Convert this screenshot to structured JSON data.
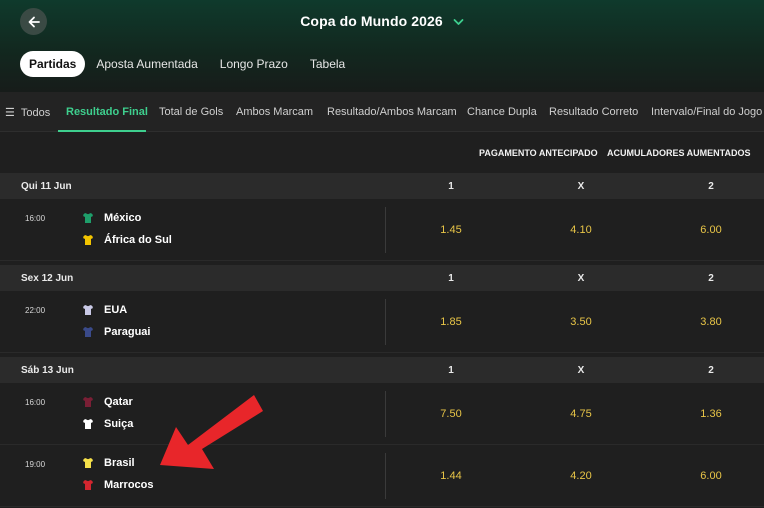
{
  "header": {
    "title": "Copa do Mundo 2026"
  },
  "top_tabs": [
    "Partidas",
    "Aposta Aumentada",
    "Longo Prazo",
    "Tabela"
  ],
  "markets": {
    "all_label": "Todos",
    "items": [
      "Resultado Final",
      "Total de Gols",
      "Ambos Marcam",
      "Resultado/Ambos Marcam",
      "Chance Dupla",
      "Resultado Correto",
      "Intervalo/Final do Jogo"
    ]
  },
  "columns": {
    "early_payout": "PAGAMENTO ANTECIPADO",
    "boosted_acca": "ACUMULADORES AUMENTADOS",
    "home": "1",
    "draw": "X",
    "away": "2"
  },
  "days": [
    {
      "date": "Qui 11 Jun",
      "matches": [
        {
          "time": "16:00",
          "home": "México",
          "away": "África do Sul",
          "odd_1": "1.45",
          "odd_x": "4.10",
          "odd_2": "6.00",
          "home_color": "#1e9e6a",
          "away_color": "#f2c400"
        }
      ]
    },
    {
      "date": "Sex 12 Jun",
      "matches": [
        {
          "time": "22:00",
          "home": "EUA",
          "away": "Paraguai",
          "odd_1": "1.85",
          "odd_x": "3.50",
          "odd_2": "3.80",
          "home_color": "#c9c9e6",
          "away_color": "#3a4a8a"
        }
      ]
    },
    {
      "date": "Sáb 13 Jun",
      "matches": [
        {
          "time": "16:00",
          "home": "Qatar",
          "away": "Suiça",
          "odd_1": "7.50",
          "odd_x": "4.75",
          "odd_2": "1.36",
          "home_color": "#7a1f35",
          "away_color": "#ffffff"
        },
        {
          "time": "19:00",
          "home": "Brasil",
          "away": "Marrocos",
          "odd_1": "1.44",
          "odd_x": "4.20",
          "odd_2": "6.00",
          "home_color": "#f5e04a",
          "away_color": "#d3262f"
        }
      ]
    }
  ],
  "colors": {
    "accent": "#3ecf8e",
    "odds": "#e8c547",
    "annotation_arrow": "#e8262a"
  }
}
